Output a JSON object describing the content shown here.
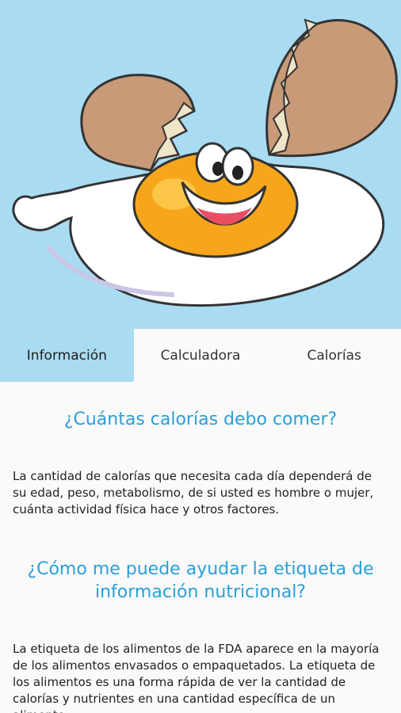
{
  "tabs": [
    {
      "label": "Información",
      "active": true
    },
    {
      "label": "Calculadora",
      "active": false
    },
    {
      "label": "Calorías",
      "active": false
    }
  ],
  "sections": [
    {
      "heading": "¿Cuántas calorías debo comer?",
      "body": "La cantidad de calorías que necesita cada día dependerá de su edad, peso, metabolismo, de si usted es hombre o mujer, cuánta actividad física hace y otros factores."
    },
    {
      "heading": "¿Cómo me puede ayudar la etiqueta de información nutricional?",
      "body": "La etiqueta de los alimentos de la FDA aparece en la mayoría de los alimentos envasados o empaquetados. La etiqueta de los alimentos es una forma rápida de ver la cantidad de calorías y nutrientes en una cantidad específica de un alimento."
    }
  ],
  "colors": {
    "header_bg": "#a9dcf2",
    "heading_text": "#2a9fd6",
    "body_text": "#222222"
  },
  "hero": {
    "icon": "cartoon-egg-illustration"
  }
}
